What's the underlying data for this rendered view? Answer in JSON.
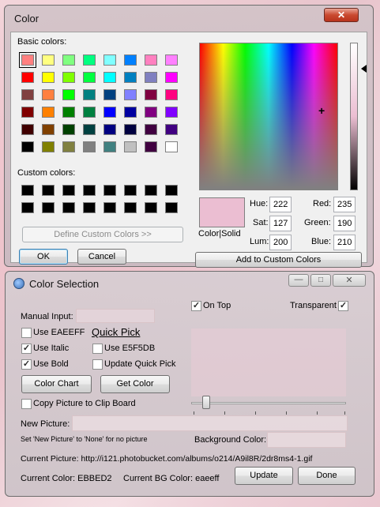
{
  "color_dialog": {
    "title": "Color",
    "close": "✕",
    "basic_colors_label": "Basic colors:",
    "custom_colors_label": "Custom colors:",
    "define_button": "Define Custom Colors >>",
    "ok_button": "OK",
    "cancel_button": "Cancel",
    "add_button": "Add to Custom Colors",
    "color_solid_label": "Color|Solid",
    "hue_label": "Hue:",
    "hue": "222",
    "sat_label": "Sat:",
    "sat": "127",
    "lum_label": "Lum:",
    "lum": "200",
    "red_label": "Red:",
    "red": "235",
    "green_label": "Green:",
    "green": "190",
    "blue_label": "Blue:",
    "blue": "210",
    "preview_color": "#ebbed2",
    "basic_colors": [
      [
        "#ff8080",
        "#ffff80",
        "#80ff80",
        "#00ff80",
        "#80ffff",
        "#0080ff",
        "#ff80c0",
        "#ff80ff"
      ],
      [
        "#ff0000",
        "#ffff00",
        "#80ff00",
        "#00ff40",
        "#00ffff",
        "#0080c0",
        "#8080c0",
        "#ff00ff"
      ],
      [
        "#804040",
        "#ff8040",
        "#00ff00",
        "#008080",
        "#004080",
        "#8080ff",
        "#800040",
        "#ff0080"
      ],
      [
        "#800000",
        "#ff8000",
        "#008000",
        "#008040",
        "#0000ff",
        "#0000a0",
        "#800080",
        "#8000ff"
      ],
      [
        "#400000",
        "#804000",
        "#004000",
        "#004040",
        "#000080",
        "#000040",
        "#400040",
        "#400080"
      ],
      [
        "#000000",
        "#808000",
        "#808040",
        "#808080",
        "#408080",
        "#c0c0c0",
        "#400040",
        "#ffffff"
      ]
    ],
    "custom_colors": [
      [
        "#000000",
        "#000000",
        "#000000",
        "#000000",
        "#000000",
        "#000000",
        "#000000",
        "#000000"
      ],
      [
        "#000000",
        "#000000",
        "#000000",
        "#000000",
        "#000000",
        "#000000",
        "#000000",
        "#000000"
      ]
    ]
  },
  "selection": {
    "title": "Color Selection",
    "on_top": "On Top",
    "transparent": "Transparent",
    "manual_input": "Manual Input:",
    "use_eaeeff": "Use EAEEFF",
    "quick_pick": "Quick Pick",
    "use_italic": "Use Italic",
    "use_e5f5db": "Use E5F5DB",
    "use_bold": "Use Bold",
    "update_quick_pick": "Update Quick Pick",
    "color_chart": "Color Chart",
    "get_color": "Get Color",
    "copy_picture": "Copy Picture to Clip Board",
    "new_picture": "New Picture:",
    "hint": "Set 'New Picture' to 'None' for no picture",
    "background_color": "Background Color:",
    "current_picture": "Current Picture: http://i121.photobucket.com/albums/o214/A9il8R/2dr8ms4-1.gif",
    "current_color": "Current Color: EBBED2",
    "current_bg": "Current BG Color: eaeeff",
    "update": "Update",
    "done": "Done",
    "slider_value": 0.05
  }
}
